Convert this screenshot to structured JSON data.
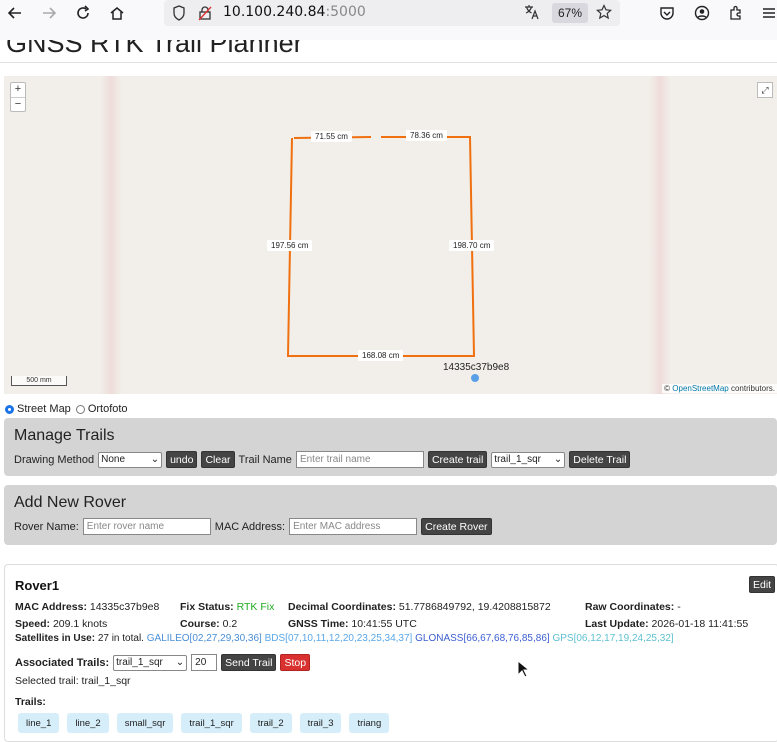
{
  "browser": {
    "url_host": "10.100.240.84",
    "url_port": ":5000",
    "zoom": "67%"
  },
  "page": {
    "title": "GNSS RTK Trail Planner"
  },
  "map": {
    "edge_labels": [
      "71.55 cm",
      "78.36 cm",
      "197.56 cm",
      "198.70 cm",
      "168.08 cm"
    ],
    "rover_label": "14335c37b9e8",
    "scale": "500 mm",
    "attribution_prefix": "© ",
    "attribution_link": "OpenStreetMap",
    "attribution_suffix": " contributors.",
    "zoom_in": "+",
    "zoom_out": "−",
    "fullscreen": "⤢",
    "trail_color": "#f07010"
  },
  "layers": {
    "street": "Street Map",
    "ortho": "Ortofoto",
    "selected": "Street Map"
  },
  "manage_trails": {
    "heading": "Manage Trails",
    "drawing_method_label": "Drawing Method",
    "drawing_method_value": "None",
    "undo": "undo",
    "clear": "Clear",
    "trail_name_label": "Trail Name",
    "trail_name_placeholder": "Enter trail name",
    "create_trail": "Create trail",
    "trail_select_value": "trail_1_sqr",
    "delete_trail": "Delete Trail"
  },
  "add_rover": {
    "heading": "Add New Rover",
    "rover_name_label": "Rover Name:",
    "rover_name_placeholder": "Enter rover name",
    "mac_label": "MAC Address:",
    "mac_placeholder": "Enter MAC address",
    "create_rover": "Create Rover"
  },
  "rover": {
    "name": "Rover1",
    "edit": "Edit",
    "mac_label": "MAC Address:",
    "mac": "14335c37b9e8",
    "fix_label": "Fix Status:",
    "fix": "RTK Fix",
    "dec_label": "Decimal Coordinates:",
    "dec": "51.7786849792, 19.4208815872",
    "raw_label": "Raw Coordinates:",
    "raw": "-",
    "speed_label": "Speed:",
    "speed": "209.1 knots",
    "course_label": "Course:",
    "course": "0.2",
    "gnss_time_label": "GNSS Time:",
    "gnss_time": "10:41:55 UTC",
    "last_update_label": "Last Update:",
    "last_update": "2026-01-18 11:41:55",
    "sats_label": "Satellites in Use:",
    "sats_total": "27 in total.",
    "galileo": "GALILEO[02,27,29,30,36]",
    "bds": "BDS[07,10,11,12,20,23,25,34,37]",
    "glonass": "GLONASS[66,67,68,76,85,86]",
    "gps": "GPS[06,12,17,19,24,25,32]",
    "assoc_label": "Associated Trails:",
    "assoc_value": "trail_1_sqr",
    "repeat_value": "20",
    "send_trail": "Send Trail",
    "stop": "Stop",
    "selected_trail": "Selected trail: trail_1_sqr",
    "trails_label": "Trails:",
    "trails": [
      "line_1",
      "line_2",
      "small_sqr",
      "trail_1_sqr",
      "trail_2",
      "trail_3",
      "triang"
    ]
  }
}
